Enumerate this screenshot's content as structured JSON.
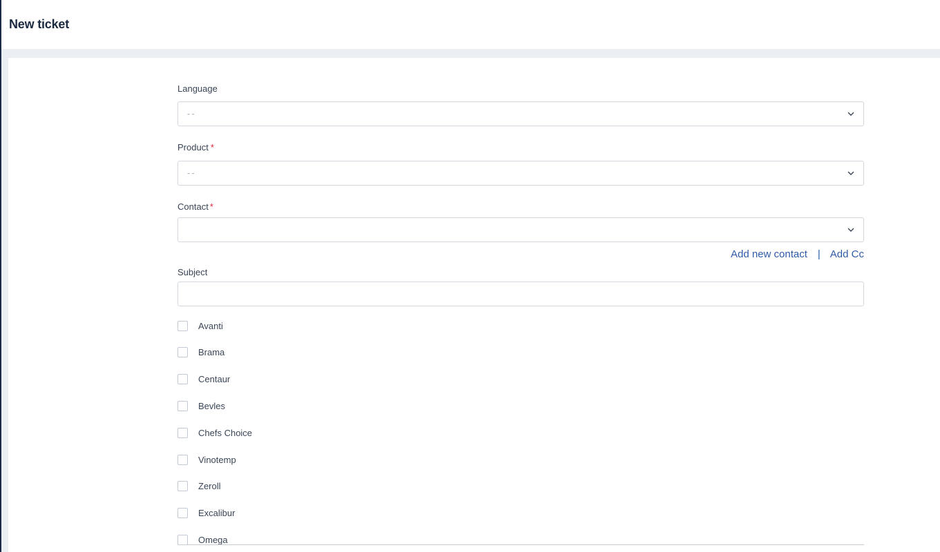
{
  "header": {
    "title": "New ticket"
  },
  "form": {
    "language": {
      "label": "Language",
      "value": "--"
    },
    "product": {
      "label": "Product",
      "required_mark": "*",
      "value": "--"
    },
    "contact": {
      "label": "Contact",
      "required_mark": "*",
      "value": ""
    },
    "links": {
      "add_contact": "Add new contact",
      "separator": "|",
      "add_cc": "Add Cc"
    },
    "subject": {
      "label": "Subject",
      "value": ""
    },
    "brands": [
      {
        "label": "Avanti",
        "checked": false
      },
      {
        "label": "Brama",
        "checked": false
      },
      {
        "label": "Centaur",
        "checked": false
      },
      {
        "label": "Bevles",
        "checked": false
      },
      {
        "label": "Chefs Choice",
        "checked": false
      },
      {
        "label": "Vinotemp",
        "checked": false
      },
      {
        "label": "Zeroll",
        "checked": false
      },
      {
        "label": "Excalibur",
        "checked": false
      },
      {
        "label": "Omega",
        "checked": false
      }
    ]
  },
  "colors": {
    "accent_link": "#2f5aa8",
    "required": "#e0283d",
    "title": "#1b2a41"
  }
}
